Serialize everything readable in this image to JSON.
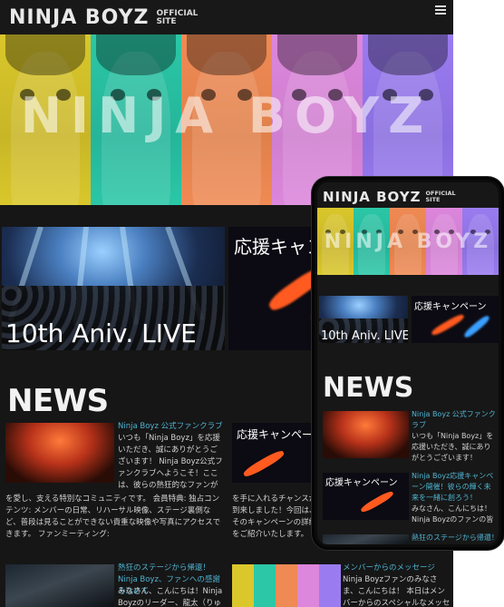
{
  "brand": {
    "name": "NINJA BOYZ",
    "sub_line1": "OFFICIAL",
    "sub_line2": "SITE"
  },
  "hero": {
    "title": "NINJA BOYZ",
    "stripe_colors": [
      "#c9b627",
      "#25b59a",
      "#e0804a",
      "#cf7fcf",
      "#8a6fe0"
    ],
    "tint_colors": [
      "#d9c72b",
      "#2bc7a6",
      "#f08a55",
      "#dc86dc",
      "#9a7cf0"
    ]
  },
  "tiles": {
    "live_caption": "10th Aniv. LIVE",
    "campaign_caption": "応援キャンペーン"
  },
  "news": {
    "heading": "NEWS",
    "posts": [
      {
        "title": "Ninja Boyz 公式ファンクラブ",
        "excerpt": "いつも「Ninja Boyz」を応援いただき、誠にありがとうございます！ Ninja Boyz公式ファンクラブへようこそ！ここは、彼らの熱狂的なファンが集まり、共に彼らの音楽とパフォーマンス",
        "wrap": "を愛し、支える特別なコミュニティです。 会員特典: 独占コンテンツ: メンバーの日常、リハーサル映像、ステージ裏側など、普段は見ることができない貴重な映像や写真にアクセスできます。 ファンミーティング:"
      },
      {
        "title": "Ninja Boyz応援キャンペーン開催！彼らの輝く未来を一緒に創ろう！",
        "excerpt": "みなさん、こんにちは！ Ninja Boyzのファンの皆",
        "wrap": "を手に入れるチャンスが到来しました！今回は、そのキャンペーンの詳細をご紹介いたします。 キャンペーンでは、彼らへの応援を行うことで、素敵な特典がもらえます。 パフォー"
      },
      {
        "title": "熱狂のステージから帰還！Ninja Boyz、ファンへの感謝を込めて",
        "excerpt": "みなさん、こんにちは！Ninja Boyzのリーダー、龍太（りゅう"
      },
      {
        "title": "メンバーからのメッセージ",
        "excerpt": "Ninja Boyzファンのみなさま、こんにちは！ 本日はメンバーからのスペシャルなメッセージを"
      }
    ]
  },
  "phone": {
    "posts": [
      {
        "title": "Ninja Boyz 公式ファンクラブ",
        "excerpt": "いつも「Ninja Boyz」を応援いただき、誠にありがとうございます！ Ninja"
      },
      {
        "title": "Ninja Boyz応援キャンペーン開催！彼らの輝く未来を一緒に創ろう！",
        "excerpt": "みなさん、こんにちは！ Ninja Boyzのファンの皆"
      },
      {
        "title": "熱狂のステージから帰還！"
      }
    ]
  }
}
